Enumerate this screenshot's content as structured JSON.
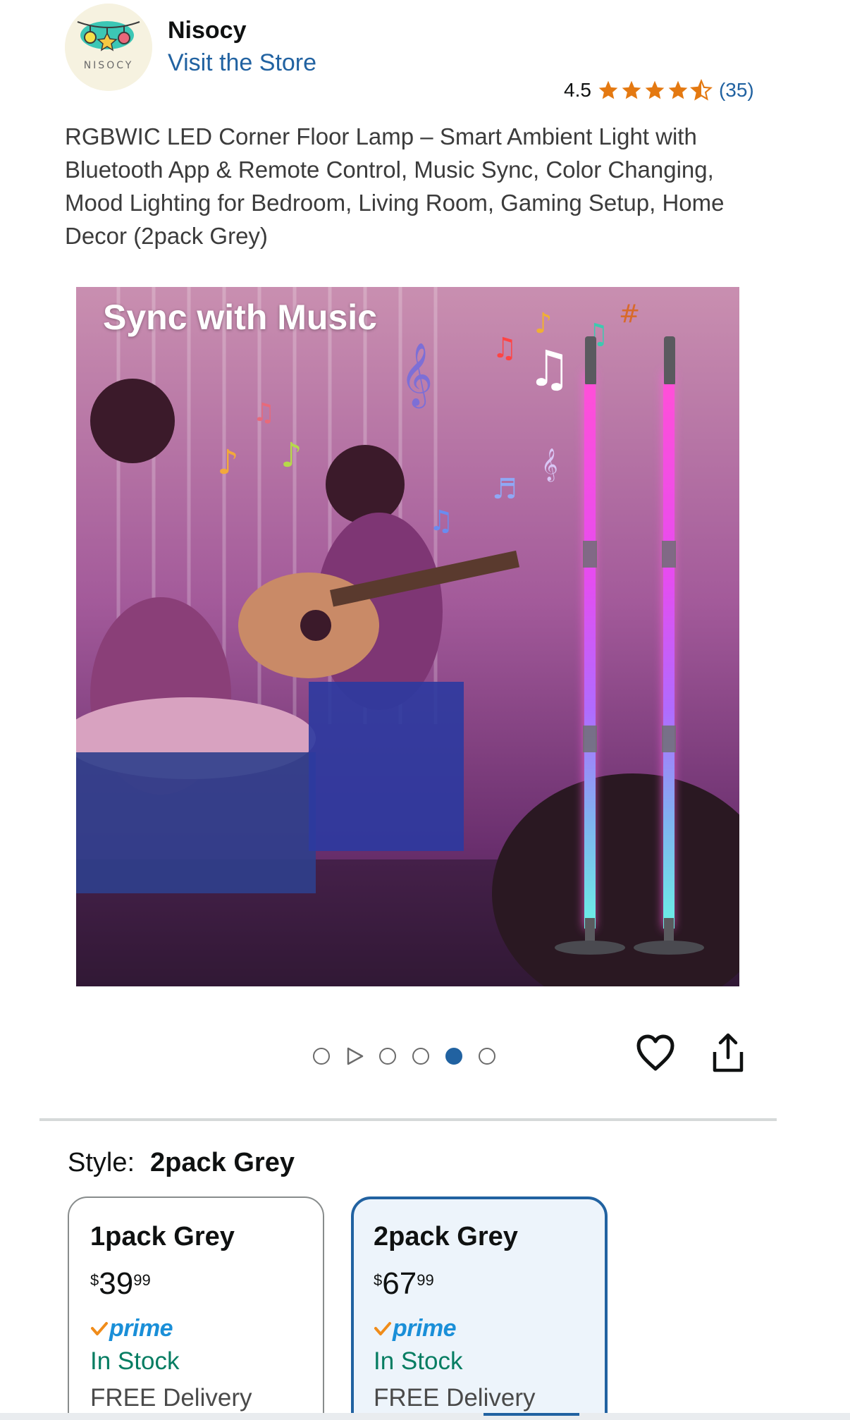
{
  "brand": {
    "logo_text": "NISOCY",
    "name": "Nisocy",
    "visit_store": "Visit the Store"
  },
  "rating": {
    "value": "4.5",
    "stars": 4.5,
    "count": "(35)",
    "star_color": "#f3a847"
  },
  "product": {
    "title": "RGBWIC LED Corner Floor Lamp – Smart Ambient Light with Bluetooth App & Remote Control, Music Sync, Color Changing, Mood Lighting for Bedroom, Living Room, Gaming Setup, Home Decor (2pack Grey)"
  },
  "image": {
    "caption": "Sync with Music"
  },
  "carousel": {
    "items": [
      "dot",
      "play",
      "dot",
      "dot",
      "dot-active",
      "dot"
    ],
    "active_index": 4
  },
  "actions": {
    "wishlist_icon": "heart-icon",
    "share_icon": "share-icon"
  },
  "style": {
    "label": "Style:",
    "selected": "2pack Grey"
  },
  "options": [
    {
      "name": "1pack Grey",
      "currency": "$",
      "price_whole": "39",
      "price_fraction": "99",
      "prime": "prime",
      "stock": "In Stock",
      "delivery": "FREE Delivery",
      "selected": false
    },
    {
      "name": "2pack Grey",
      "currency": "$",
      "price_whole": "67",
      "price_fraction": "99",
      "prime": "prime",
      "stock": "In Stock",
      "delivery": "FREE Delivery",
      "selected": true
    }
  ],
  "colors": {
    "link": "#2162a1",
    "in_stock": "#067d62",
    "prime_blue": "#1a8fd8",
    "prime_check": "#f08c1a",
    "selected_border": "#2162a1",
    "selected_bg": "#edf4fb"
  }
}
